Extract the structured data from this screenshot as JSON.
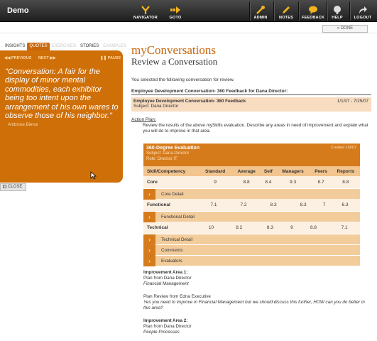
{
  "app": {
    "title": "Demo"
  },
  "nav": {
    "navigator": "NAVIGATOR",
    "goto": "GOTO",
    "admin": "ADMIN",
    "notes": "NOTES",
    "feedback": "FEEDBACK",
    "help": "HELP",
    "logout": "LOGOUT"
  },
  "done_label": "» DONE",
  "left": {
    "tabs": [
      {
        "label": "INSIGHTS"
      },
      {
        "label": "QUOTES"
      },
      {
        "label": "EXERCISES"
      },
      {
        "label": "STORIES"
      },
      {
        "label": "EXAMPLES"
      }
    ],
    "previous": "◀◀ PREVIOUS",
    "next": "NEXT ▶▶",
    "pause": "❚❚ PAUSE",
    "quote": "\"Conversation: A fair for the display of minor mental commodities, each exhibitor being too intent upon the arrangement of his own wares to observe those of his neighbor.\"",
    "author": "Ambrose Bierce",
    "close": "CLOSE"
  },
  "main": {
    "title": "myConversations",
    "subtitle": "Review a Conversation",
    "intro": "You selected the following conversation for review.",
    "conv_heading": "Employee Development Conversation- 360 Feedback for Dana Director:",
    "conv_box_title": "Employee Development Conversation- 360 Feedback",
    "conv_box_dates": "1/1/07 - 7/25/07",
    "conv_box_subject": "Subject: Dana Director",
    "action_plan_label": "Action Plan:",
    "action_plan_text": "Review the results of the above mySkills evaluation. Describe any areas in need of improvement and explain what you will do to improve in that area."
  },
  "eval": {
    "name": "360-Degree Evaluation",
    "subject": "Subject: Dana Director",
    "role": "Role: Director IT",
    "created": "Created 1/9/07",
    "headers": [
      "Skill/Competency",
      "Standard",
      "Average",
      "Self",
      "Managers",
      "Peers",
      "Reports"
    ],
    "rows": [
      {
        "name": "Core",
        "values": [
          "9",
          "8.8",
          "8.4",
          "9.3",
          "8.7",
          "8.8"
        ],
        "detail": "Core Detail"
      },
      {
        "name": "Functional",
        "values": [
          "7.1",
          "7.2",
          "8.3",
          "8.3",
          "7",
          "6.3"
        ],
        "detail": "Functional Detail"
      },
      {
        "name": "Technical",
        "values": [
          "10",
          "8.2",
          "8.3",
          "9",
          "8.8",
          "7.1"
        ],
        "detail": "Technical Detail"
      }
    ],
    "comments": "Comments",
    "evaluators": "Evaluators"
  },
  "improvement": {
    "a1_title": "Improvement Area 1:",
    "a1_plan": "Plan from Dana Director",
    "a1_topic": "Financial Management",
    "review_from": "Plan Review from Edna Executive",
    "review_text": "Yes you need to improve in Financial Management but we should discuss this further, HOW can you do better in this area?",
    "a2_title": "Improvement Area 2:",
    "a2_plan": "Plan from Dana Director",
    "a2_topic": "People Processes"
  }
}
